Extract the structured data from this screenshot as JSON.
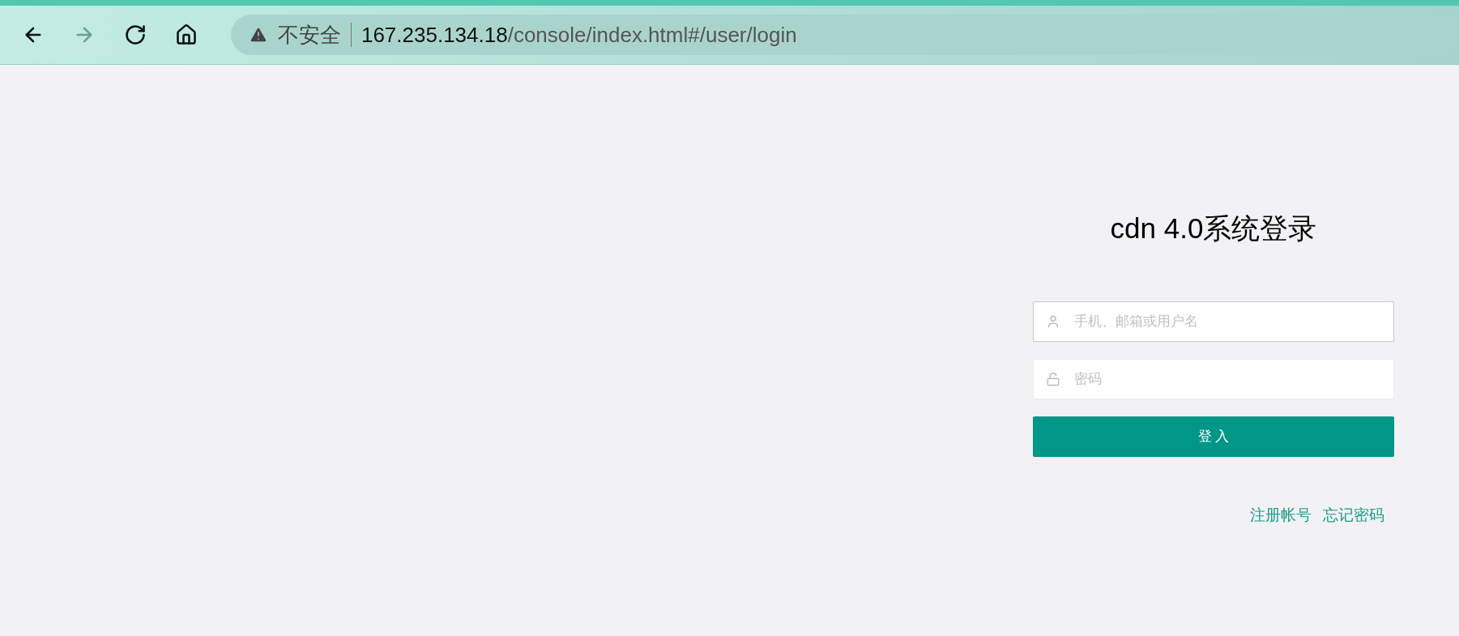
{
  "browser": {
    "nav_buttons": [
      {
        "kind": "back",
        "disabled": false
      },
      {
        "kind": "forward",
        "disabled": true
      },
      {
        "kind": "reload",
        "disabled": false
      },
      {
        "kind": "home",
        "disabled": false
      }
    ],
    "security_label": "不安全",
    "url_host": "167.235.134.18",
    "url_path": "/console/index.html#/user/login"
  },
  "login": {
    "title": "cdn 4.0系统登录",
    "fields": [
      {
        "kind": "user",
        "placeholder": "手机、邮箱或用户名",
        "focused": true
      },
      {
        "kind": "password",
        "placeholder": "密码",
        "focused": false
      }
    ],
    "submit": "登 入",
    "links": [
      "注册帐号",
      "忘记密码"
    ]
  }
}
